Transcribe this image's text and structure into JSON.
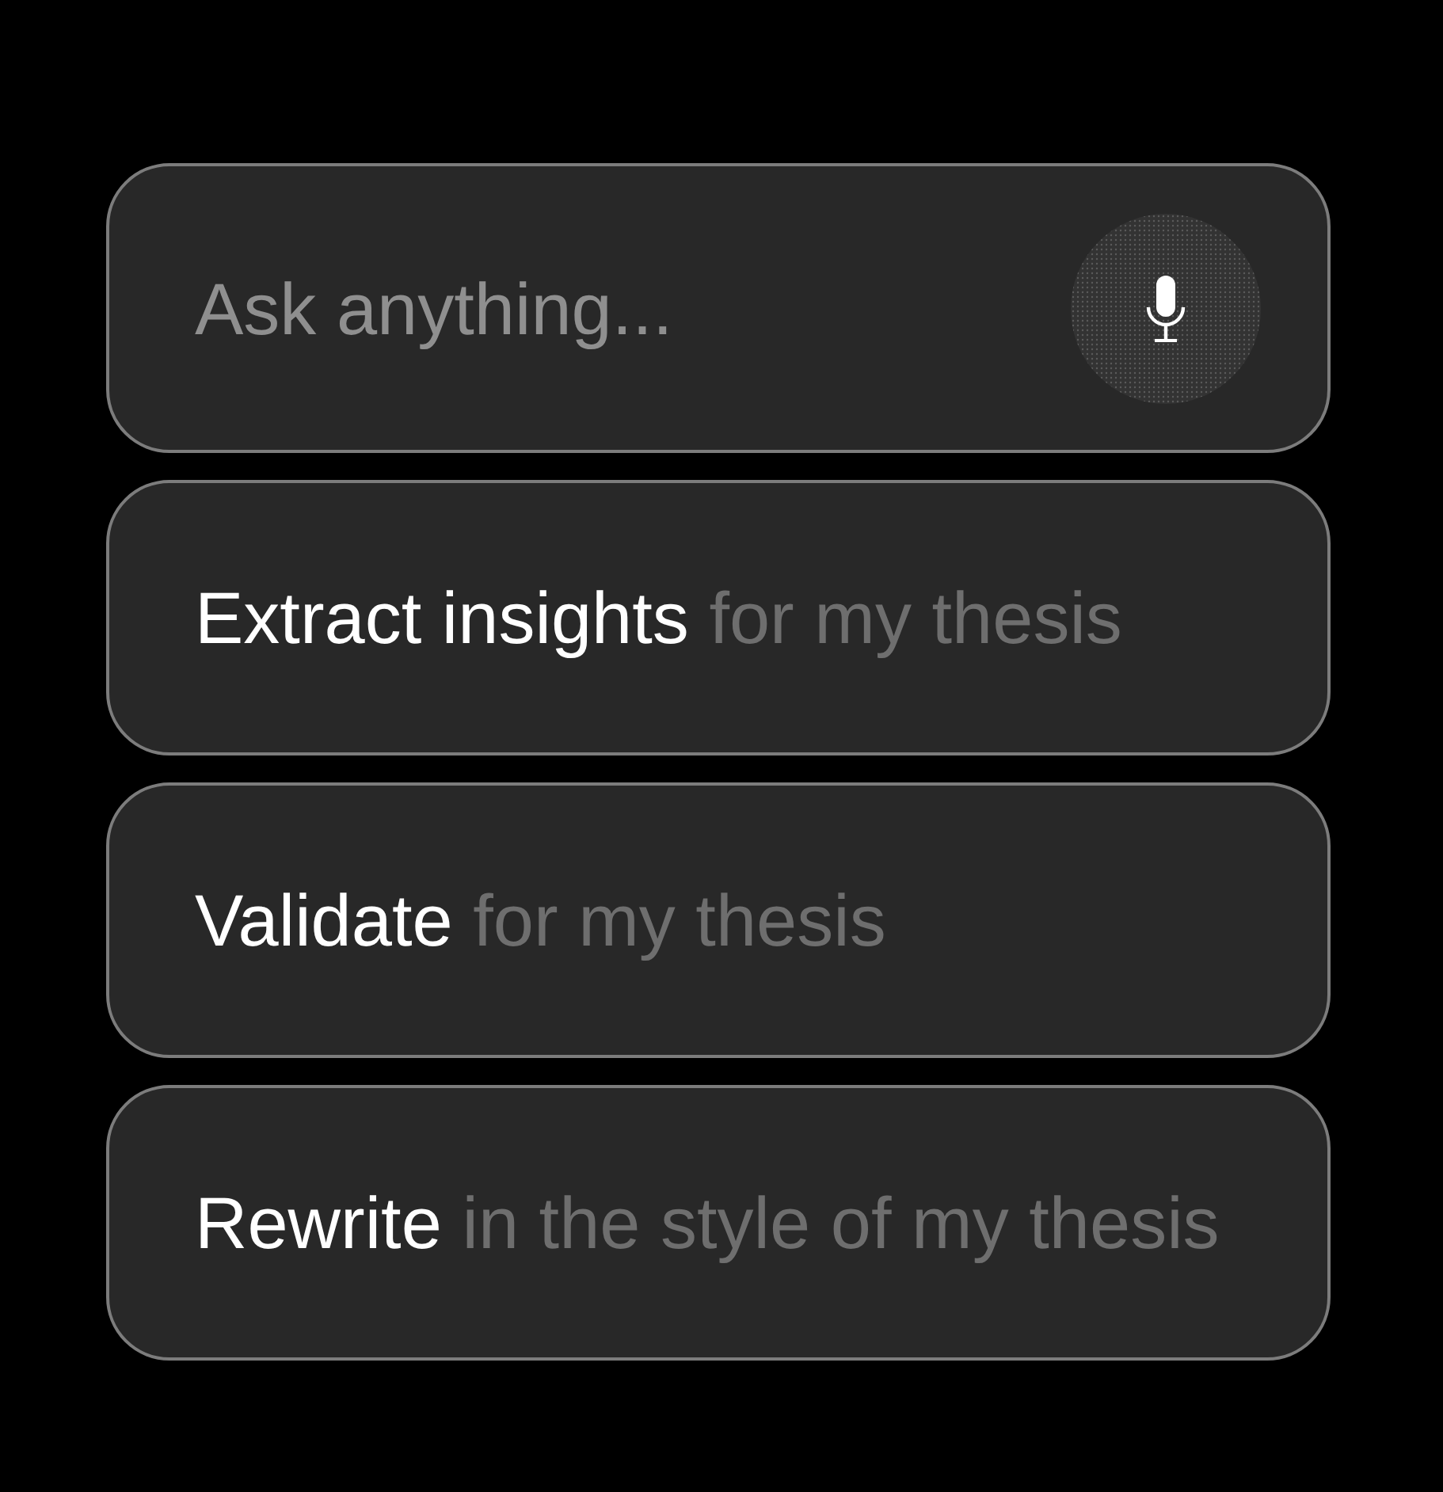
{
  "prompt": {
    "placeholder": "Ask anything..."
  },
  "suggestions": [
    {
      "action": "Extract insights",
      "detail": "for my thesis"
    },
    {
      "action": "Validate",
      "detail": "for my thesis"
    },
    {
      "action": "Rewrite",
      "detail": "in the style of my thesis"
    }
  ]
}
